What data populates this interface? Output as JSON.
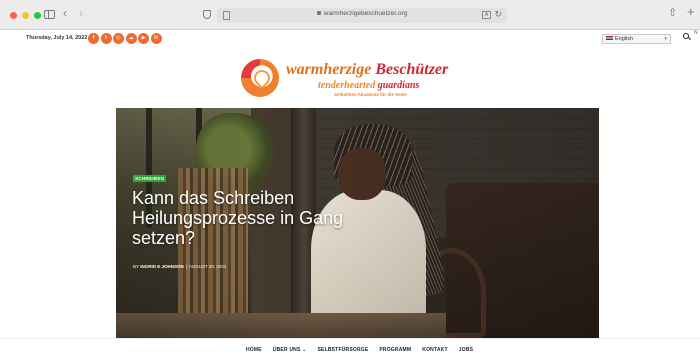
{
  "browser": {
    "url": "warmherzigebeschuetzer.org",
    "corner_badge": "N"
  },
  "topbar": {
    "date": "Thursday, July 14, 2022",
    "socials": [
      {
        "name": "facebook-icon",
        "glyph": "f"
      },
      {
        "name": "twitter-icon",
        "glyph": "t"
      },
      {
        "name": "instagram-icon",
        "glyph": "◎"
      },
      {
        "name": "soundcloud-icon",
        "glyph": "☁"
      },
      {
        "name": "youtube-icon",
        "glyph": "▶"
      },
      {
        "name": "email-icon",
        "glyph": "✉"
      }
    ],
    "language": "English"
  },
  "logo": {
    "title_a": "warmherzige",
    "title_b": "Beschützer",
    "sub_a": "tenderhearted",
    "sub_b": "guardians",
    "tagline": "Selbstlöse Akademie für die Seele"
  },
  "hero": {
    "category": "SCHREIBEN",
    "title": "Kann das Schreiben Heilungsprozesse in Gang setzen?",
    "byline_prefix": "BY",
    "author": "INGRID E JOHNSON",
    "date": "AUGUST 20, 2021"
  },
  "nav": {
    "items": [
      "HOME",
      "ÜBER UNS ⌄",
      "SELBSTFÜRSORGE",
      "PROGRAMM",
      "KONTAKT",
      "JOBS"
    ]
  },
  "colors": {
    "accent": "#ef6b2f",
    "brand_red": "#d4232b",
    "badge_green": "#2da53b"
  }
}
